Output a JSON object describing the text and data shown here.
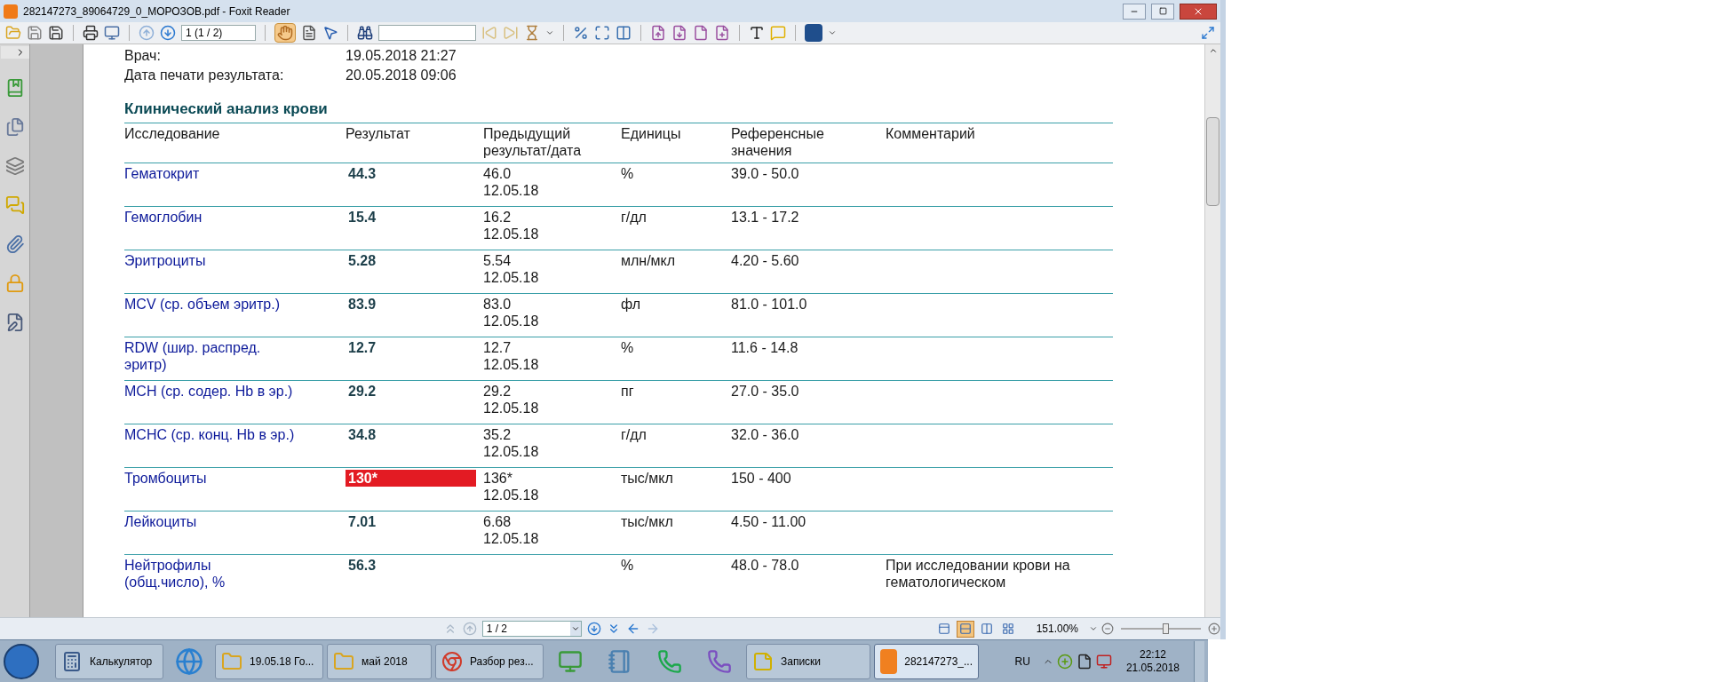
{
  "window": {
    "title": "282147273_89064729_0_МОРОЗОВ.pdf - Foxit Reader"
  },
  "toolbar": {
    "page_field": "1 (1 / 2)",
    "hand_tool_selected": true
  },
  "document": {
    "info": [
      {
        "label": "Врач:",
        "value": "19.05.2018 21:27"
      },
      {
        "label": "Дата печати результата:",
        "value": "20.05.2018 09:06"
      }
    ],
    "section_title": "Клинический анализ крови",
    "columns": [
      "Исследование",
      "Результат",
      "Предыдущий\nрезультат/дата",
      "Единицы",
      "Референсные\nзначения",
      "Комментарий"
    ],
    "rows": [
      {
        "test": "Гематокрит",
        "result": "44.3",
        "flagged": false,
        "previous": "46.0",
        "previous_date": "12.05.18",
        "units": "%",
        "reference": "39.0 - 50.0"
      },
      {
        "test": "Гемоглобин",
        "result": "15.4",
        "flagged": false,
        "previous": "16.2",
        "previous_date": "12.05.18",
        "units": "г/дл",
        "reference": "13.1 - 17.2"
      },
      {
        "test": "Эритроциты",
        "result": "5.28",
        "flagged": false,
        "previous": "5.54",
        "previous_date": "12.05.18",
        "units": "млн/мкл",
        "reference": "4.20 - 5.60"
      },
      {
        "test": "MCV (ср. объем эритр.)",
        "result": "83.9",
        "flagged": false,
        "previous": "83.0",
        "previous_date": "12.05.18",
        "units": "фл",
        "reference": "81.0 - 101.0"
      },
      {
        "test": "RDW (шир. распред.\nэритр)",
        "result": "12.7",
        "flagged": false,
        "previous": "12.7",
        "previous_date": "12.05.18",
        "units": "%",
        "reference": "11.6 - 14.8"
      },
      {
        "test": "MCH (ср. содер. Hb в эр.)",
        "result": "29.2",
        "flagged": false,
        "previous": "29.2",
        "previous_date": "12.05.18",
        "units": "пг",
        "reference": "27.0 - 35.0"
      },
      {
        "test": "MCHC (ср. конц. Hb в эр.)",
        "result": "34.8",
        "flagged": false,
        "previous": "35.2",
        "previous_date": "12.05.18",
        "units": "г/дл",
        "reference": "32.0 - 36.0"
      },
      {
        "test": "Тромбоциты",
        "result": "130*",
        "flagged": true,
        "previous": "136*",
        "previous_date": "12.05.18",
        "units": "тыс/мкл",
        "reference": "150 - 400"
      },
      {
        "test": "Лейкоциты",
        "result": "7.01",
        "flagged": false,
        "previous": "6.68",
        "previous_date": "12.05.18",
        "units": "тыс/мкл",
        "reference": "4.50 - 11.00"
      },
      {
        "test": "Нейтрофилы\n(общ.число), %",
        "result": "56.3",
        "flagged": false,
        "units": "%",
        "reference": "48.0 - 78.0",
        "comment": "При исследовании крови на\nгематологическом"
      }
    ]
  },
  "status_bar": {
    "page_field": "1 / 2",
    "view_modes": [
      {
        "selected": false
      },
      {
        "selected": true
      },
      {
        "selected": false
      },
      {
        "selected": false
      }
    ],
    "zoom": "151.00%",
    "zoom_slider": {
      "level": 0.56
    }
  },
  "taskbar": {
    "buttons": [
      {
        "label": "Калькулятор",
        "selected": false
      },
      {
        "label": "19.05.18 Го...",
        "selected": false
      },
      {
        "label": "май 2018",
        "selected": false
      },
      {
        "label": "Разбор рез...",
        "selected": false
      },
      {
        "label": "Записки",
        "selected": false
      },
      {
        "label": "282147273_...",
        "selected": true
      }
    ],
    "language": "RU",
    "time": "22:12",
    "date": "21.05.2018"
  }
}
